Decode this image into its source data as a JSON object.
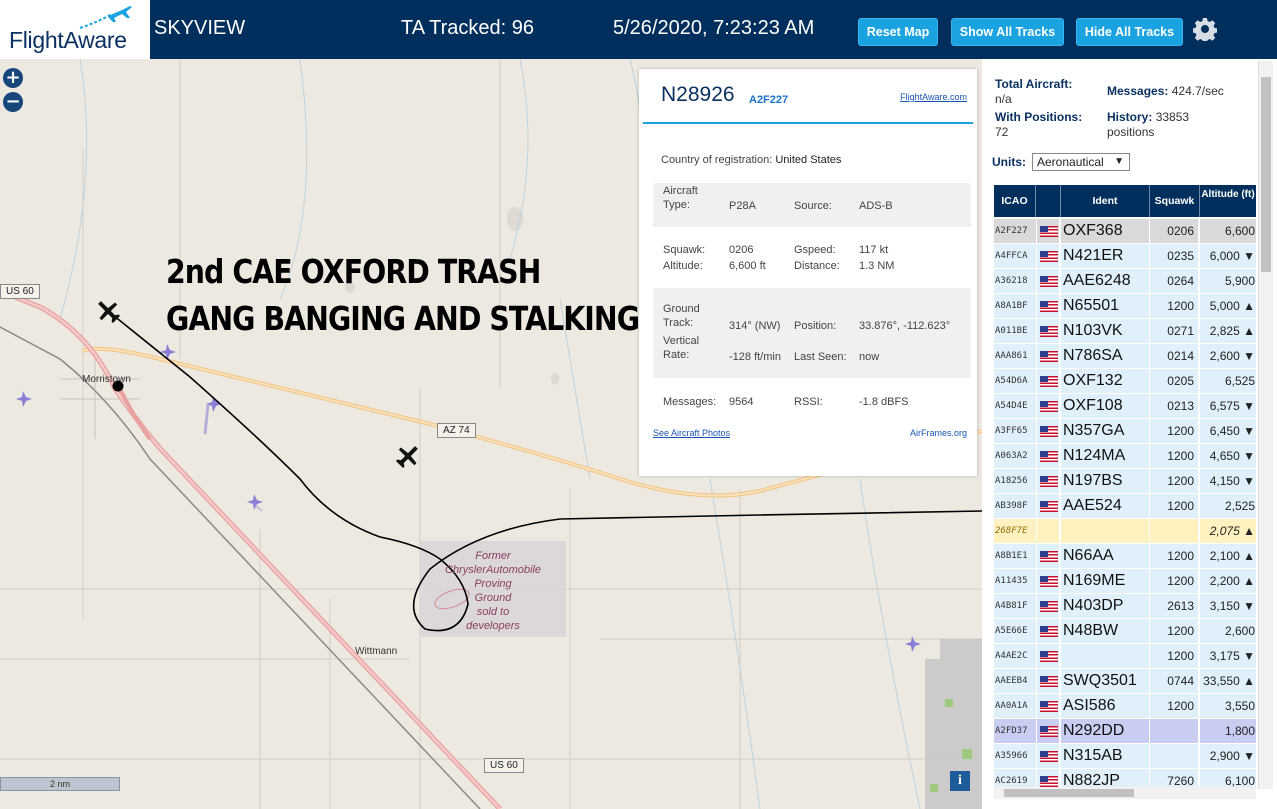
{
  "header": {
    "logo_text": "FlightAware",
    "app_title": "SKYVIEW",
    "tracked": "TA Tracked: 96",
    "datetime": "5/26/2020, 7:23:23 AM",
    "buttons": {
      "reset": "Reset Map",
      "show_tracks": "Show All Tracks",
      "hide_tracks": "Hide All Tracks"
    }
  },
  "map": {
    "zoom_in": "+",
    "zoom_out": "−",
    "overlay_line1": "2nd CAE OXFORD TRASH",
    "overlay_line2": "GANG BANGING AND STALKING",
    "places": {
      "morristown": "Morristown",
      "wittmann": "Wittmann"
    },
    "roads": {
      "us60_top": "US 60",
      "az74": "AZ 74",
      "us60_bottom": "US 60"
    },
    "proving_ground": [
      "Former",
      "ChryslerAutomobile",
      "Proving",
      "Ground",
      "sold to",
      "developers"
    ],
    "scale": "2 nm",
    "info": "i"
  },
  "card": {
    "registration": "N28926",
    "hex": "A2F227",
    "fa_link": "FlightAware.com",
    "country_label": "Country of registration:",
    "country": "United States",
    "aircraft_type_label": "Aircraft Type:",
    "aircraft_type": "P28A",
    "source_label": "Source:",
    "source": "ADS-B",
    "squawk_label": "Squawk:",
    "squawk": "0206",
    "gspeed_label": "Gspeed:",
    "gspeed": "117 kt",
    "altitude_label": "Altitude:",
    "altitude": "6,600 ft",
    "distance_label": "Distance:",
    "distance": "1.3 NM",
    "ground_track_label": "Ground Track:",
    "ground_track": "314° (NW)",
    "position_label": "Position:",
    "position": "33.876°, -112.623°",
    "vertical_rate_label": "Vertical Rate:",
    "vertical_rate": "-128 ft/min",
    "last_seen_label": "Last Seen:",
    "last_seen": "now",
    "messages_label": "Messages:",
    "messages": "9564",
    "rssi_label": "RSSI:",
    "rssi": "-1.8 dBFS",
    "photos_link": "See Aircraft Photos",
    "airframes_link": "AirFrames.org"
  },
  "sidebar": {
    "total_aircraft_label": "Total Aircraft:",
    "total_aircraft": "n/a",
    "messages_label": "Messages:",
    "messages": "424.7/sec",
    "with_positions_label": "With Positions:",
    "with_positions": "72",
    "history_label": "History:",
    "history": "33853 positions",
    "units_label": "Units:",
    "units_value": "Aeronautical",
    "columns": {
      "icao": "ICAO",
      "ident": "Ident",
      "squawk": "Squawk",
      "altitude": "Altitude (ft)"
    },
    "rows": [
      {
        "icao": "A2F227",
        "flag": true,
        "ident": "OXF368",
        "squawk": "0206",
        "alt": "6,600",
        "style": "grey"
      },
      {
        "icao": "A4FFCA",
        "flag": true,
        "ident": "N421ER",
        "squawk": "0235",
        "alt": "6,000 ▼",
        "style": "blue"
      },
      {
        "icao": "A36218",
        "flag": true,
        "ident": "AAE6248",
        "squawk": "0264",
        "alt": "5,900",
        "style": "blue"
      },
      {
        "icao": "A8A1BF",
        "flag": true,
        "ident": "N65501",
        "squawk": "1200",
        "alt": "5,000 ▲",
        "style": "blue"
      },
      {
        "icao": "A011BE",
        "flag": true,
        "ident": "N103VK",
        "squawk": "0271",
        "alt": "2,825 ▲",
        "style": "blue"
      },
      {
        "icao": "AAA861",
        "flag": true,
        "ident": "N786SA",
        "squawk": "0214",
        "alt": "2,600 ▼",
        "style": "blue"
      },
      {
        "icao": "A54D6A",
        "flag": true,
        "ident": "OXF132",
        "squawk": "0205",
        "alt": "6,525",
        "style": "blue"
      },
      {
        "icao": "A54D4E",
        "flag": true,
        "ident": "OXF108",
        "squawk": "0213",
        "alt": "6,575 ▼",
        "style": "blue"
      },
      {
        "icao": "A3FF65",
        "flag": true,
        "ident": "N357GA",
        "squawk": "1200",
        "alt": "6,450 ▼",
        "style": "blue"
      },
      {
        "icao": "A063A2",
        "flag": true,
        "ident": "N124MA",
        "squawk": "1200",
        "alt": "4,650 ▼",
        "style": "blue"
      },
      {
        "icao": "A18256",
        "flag": true,
        "ident": "N197BS",
        "squawk": "1200",
        "alt": "4,150 ▼",
        "style": "blue"
      },
      {
        "icao": "AB398F",
        "flag": true,
        "ident": "AAE524",
        "squawk": "1200",
        "alt": "2,525",
        "style": "blue"
      },
      {
        "icao": "268F7E",
        "flag": false,
        "ident": "",
        "squawk": "",
        "alt": "2,075 ▲",
        "style": "yellow"
      },
      {
        "icao": "A8B1E1",
        "flag": true,
        "ident": "N66AA",
        "squawk": "1200",
        "alt": "2,100 ▲",
        "style": "blue"
      },
      {
        "icao": "A11435",
        "flag": true,
        "ident": "N169ME",
        "squawk": "1200",
        "alt": "2,200 ▲",
        "style": "blue"
      },
      {
        "icao": "A4B81F",
        "flag": true,
        "ident": "N403DP",
        "squawk": "2613",
        "alt": "3,150 ▼",
        "style": "blue"
      },
      {
        "icao": "A5E66E",
        "flag": true,
        "ident": "N48BW",
        "squawk": "1200",
        "alt": "2,600",
        "style": "blue"
      },
      {
        "icao": "A4AE2C",
        "flag": true,
        "ident": "",
        "squawk": "1200",
        "alt": "3,175 ▼",
        "style": "blue"
      },
      {
        "icao": "AAEEB4",
        "flag": true,
        "ident": "SWQ3501",
        "squawk": "0744",
        "alt": "33,550 ▲",
        "style": "blue"
      },
      {
        "icao": "AA0A1A",
        "flag": true,
        "ident": "ASI586",
        "squawk": "1200",
        "alt": "3,550",
        "style": "blue"
      },
      {
        "icao": "A2FD37",
        "flag": true,
        "ident": "N292DD",
        "squawk": "",
        "alt": "1,800",
        "style": "purple"
      },
      {
        "icao": "A35966",
        "flag": true,
        "ident": "N315AB",
        "squawk": "",
        "alt": "2,900 ▼",
        "style": "blue"
      },
      {
        "icao": "AC2619",
        "flag": true,
        "ident": "N882JP",
        "squawk": "7260",
        "alt": "6,100",
        "style": "blue"
      }
    ]
  },
  "colors": {
    "header_bg": "#002f5d",
    "button": "#1aa3e0",
    "accent": "#0a3161",
    "row_blue": "#dff0fb",
    "row_yellow": "#fff2c0"
  }
}
